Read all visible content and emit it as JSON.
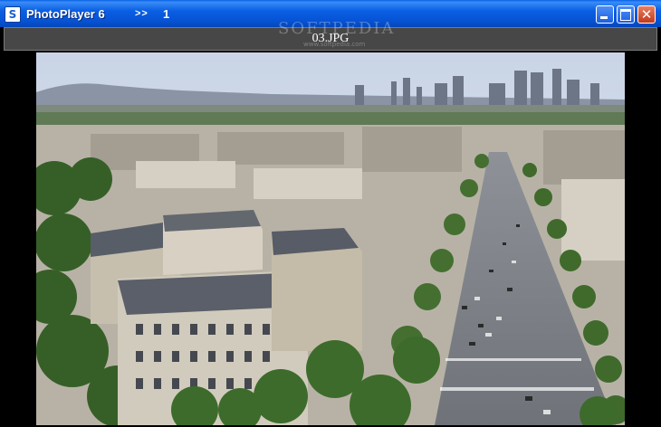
{
  "window": {
    "title": "PhotoPlayer 6",
    "nav_arrows": ">>",
    "page_number": "1",
    "icon_letter": "S",
    "controls": {
      "minimize": "minimize-icon",
      "maximize": "maximize-icon",
      "close": "close-icon",
      "close_glyph": "✕"
    }
  },
  "file": {
    "name": "03.JPG"
  },
  "watermark": {
    "text": "SOFTPEDIA",
    "url": "www.softpedia.com"
  },
  "colors": {
    "titlebar": "#0753d6",
    "filebar": "#474747",
    "close": "#c2391b"
  }
}
